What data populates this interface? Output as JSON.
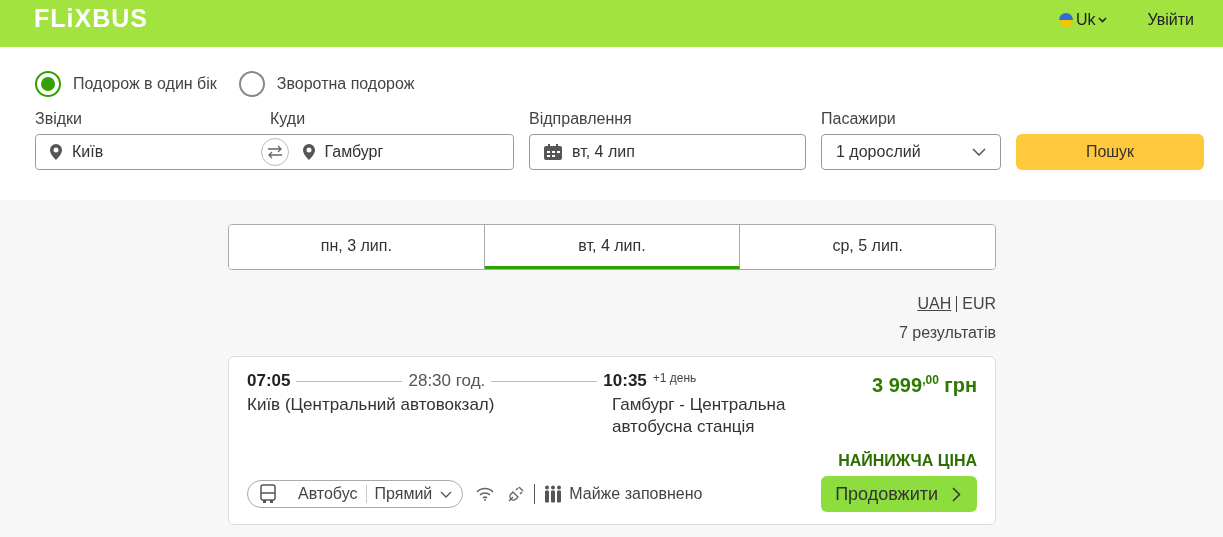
{
  "header": {
    "logo": "FLiXBUS",
    "language": "Uk",
    "login": "Увійти"
  },
  "trip_type": [
    {
      "label": "Подорож в один бік",
      "selected": true
    },
    {
      "label": "Зворотна подорож",
      "selected": false
    }
  ],
  "search": {
    "from_label": "Звідки",
    "from": "Київ",
    "to_label": "Куди",
    "to": "Гамбург",
    "date_label": "Відправлення",
    "date": "вт, 4 лип",
    "passengers_label": "Пасажири",
    "passengers": "1 дорослий",
    "button": "Пошук"
  },
  "date_tabs": [
    {
      "label": "пн, 3 лип.",
      "selected": false
    },
    {
      "label": "вт, 4 лип.",
      "selected": true
    },
    {
      "label": "ср, 5 лип.",
      "selected": false
    }
  ],
  "currencies": [
    {
      "label": "UAH",
      "selected": true
    },
    {
      "label": "EUR",
      "selected": false
    }
  ],
  "results_count": "7 результатів",
  "results": [
    {
      "departure_time": "07:05",
      "duration": "28:30 год.",
      "arrival_time": "10:35",
      "day_offset": "+1 день",
      "from": "Київ (Центральний автовокзал)",
      "to": "Гамбург - Центральна автобусна станція",
      "price": "3 999$^{,00}$ грн",
      "badge": "НАЙНИЖЧА ЦІНА",
      "vehicle": "Автобус",
      "route_type": "Прямий",
      "wifi": true,
      "power": true,
      "availability": "Майже заповнено",
      "button": "Продовжити"
    }
  ]
}
